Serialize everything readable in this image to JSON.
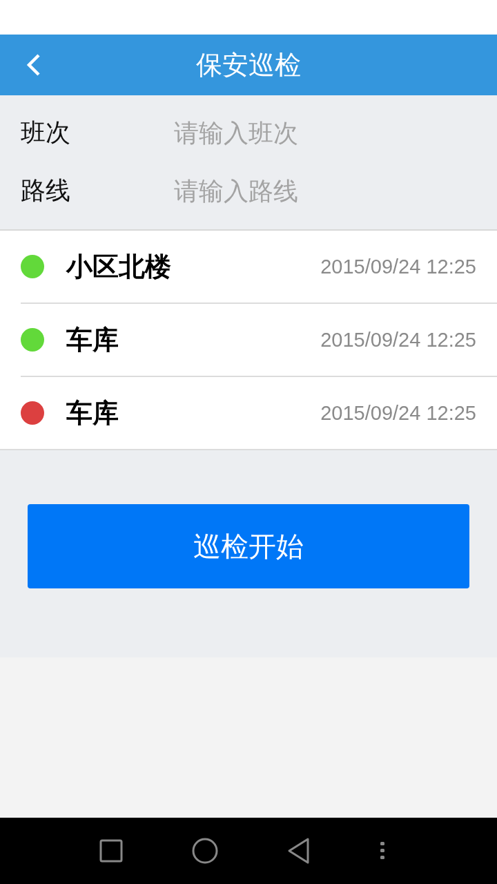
{
  "header": {
    "title": "保安巡检"
  },
  "form": [
    {
      "label": "班次",
      "placeholder": "请输入班次"
    },
    {
      "label": "路线",
      "placeholder": "请输入路线"
    }
  ],
  "checkpoints": [
    {
      "name": "小区北楼",
      "time": "2015/09/24 12:25",
      "color": "#62d93a"
    },
    {
      "name": "车库",
      "time": "2015/09/24 12:25",
      "color": "#62d93a"
    },
    {
      "name": "车库",
      "time": "2015/09/24 12:25",
      "color": "#dc4040"
    }
  ],
  "start_button": {
    "label": "巡检开始"
  }
}
